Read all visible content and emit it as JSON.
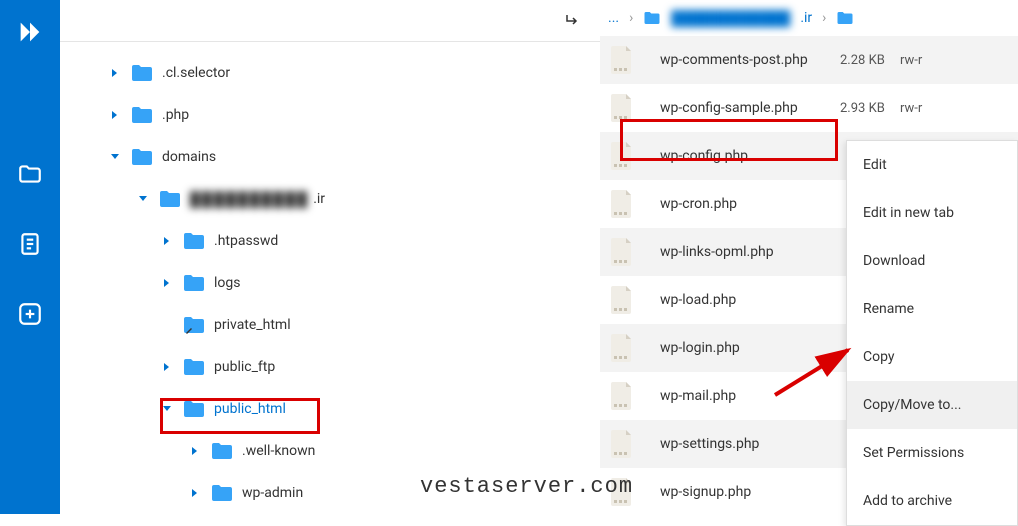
{
  "tree": {
    "items": [
      {
        "label": ".cl.selector",
        "state": "closed",
        "indent": 0
      },
      {
        "label": ".php",
        "state": "closed",
        "indent": 0
      },
      {
        "label": "domains",
        "state": "open",
        "indent": 0
      },
      {
        "label": "██████████",
        "suffix": ".ir",
        "state": "open",
        "indent": 1,
        "blurred": true
      },
      {
        "label": ".htpasswd",
        "state": "closed",
        "indent": 2
      },
      {
        "label": "logs",
        "state": "closed",
        "indent": 2
      },
      {
        "label": "private_html",
        "state": "none",
        "indent": 2,
        "link": true
      },
      {
        "label": "public_ftp",
        "state": "closed",
        "indent": 2
      },
      {
        "label": "public_html",
        "state": "open",
        "indent": 2,
        "active": true
      },
      {
        "label": ".well-known",
        "state": "closed",
        "indent": 3
      },
      {
        "label": "wp-admin",
        "state": "closed",
        "indent": 3
      }
    ]
  },
  "breadcrumb": {
    "root": "...",
    "blurred": "████████████",
    "suffix": ".ir"
  },
  "files": [
    {
      "name": "wp-comments-post.php",
      "size": "2.28 KB",
      "perm": "rw-r"
    },
    {
      "name": "wp-config-sample.php",
      "size": "2.93 KB",
      "perm": "rw-r"
    },
    {
      "name": "wp-config.php",
      "size": "",
      "perm": ""
    },
    {
      "name": "wp-cron.php",
      "size": "",
      "perm": ""
    },
    {
      "name": "wp-links-opml.php",
      "size": "",
      "perm": ""
    },
    {
      "name": "wp-load.php",
      "size": "",
      "perm": ""
    },
    {
      "name": "wp-login.php",
      "size": "",
      "perm": ""
    },
    {
      "name": "wp-mail.php",
      "size": "",
      "perm": ""
    },
    {
      "name": "wp-settings.php",
      "size": "",
      "perm": ""
    },
    {
      "name": "wp-signup.php",
      "size": "",
      "perm": ""
    }
  ],
  "context_menu": {
    "items": [
      "Edit",
      "Edit in new tab",
      "Download",
      "Rename",
      "Copy",
      "Copy/Move to...",
      "Set Permissions",
      "Add to archive"
    ],
    "hover_index": 5
  },
  "watermark": "vestaserver.com"
}
